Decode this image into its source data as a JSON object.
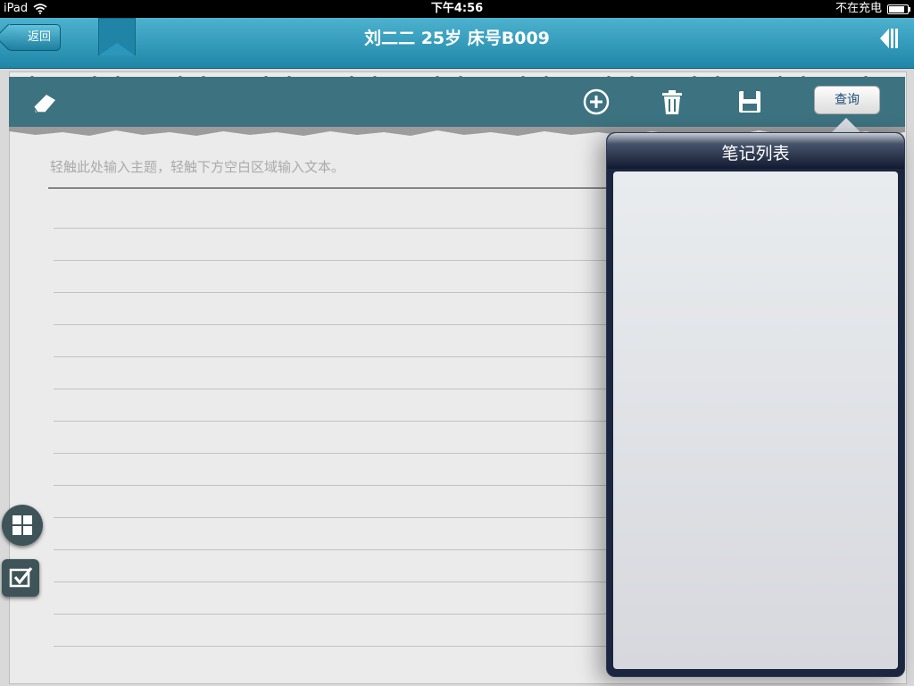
{
  "status_bar": {
    "device": "iPad",
    "time": "下午4:56",
    "charging_text": "不在充电",
    "battery_level": 0.85
  },
  "nav": {
    "back_label": "返回",
    "title": "刘二二 25岁 床号B009"
  },
  "toolbar": {
    "query_label": "查询",
    "icons": [
      "eraser-icon",
      "add-icon",
      "trash-icon",
      "save-icon"
    ]
  },
  "note": {
    "subject_placeholder": "轻触此处输入主题，轻触下方空白区域输入文本。"
  },
  "popover": {
    "title": "笔记列表"
  },
  "colors": {
    "nav_bar": "#2a9bbf",
    "toolbar": "#3d7280",
    "popover_frame": "#1b2740"
  }
}
